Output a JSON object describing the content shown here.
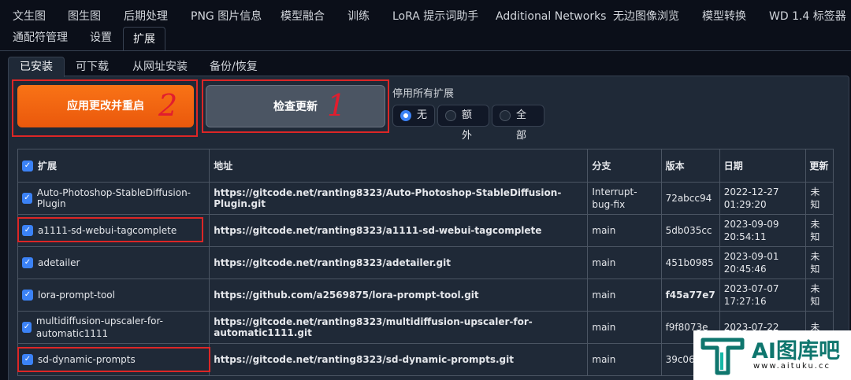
{
  "top_tabs": [
    "文生图",
    "图生图",
    "后期处理",
    "PNG 图片信息",
    "模型融合",
    "训练",
    "LoRA 提示词助手",
    "Additional Networks",
    "无边图像浏览",
    "模型转换",
    "WD 1.4 标签器",
    "通配符管理",
    "设置",
    "扩展"
  ],
  "sub_tabs": [
    "已安装",
    "可下载",
    "从网址安装",
    "备份/恢复"
  ],
  "buttons": {
    "apply": "应用更改并重启",
    "check": "检查更新"
  },
  "annotations": {
    "one": "1",
    "two": "2"
  },
  "disable": {
    "label": "停用所有扩展",
    "options": [
      "无",
      "额外",
      "全部"
    ],
    "selected": "无"
  },
  "table": {
    "headers": [
      "扩展",
      "地址",
      "分支",
      "版本",
      "日期",
      "更新"
    ],
    "rows": [
      {
        "name": "Auto-Photoshop-StableDiffusion-Plugin",
        "url": "https://gitcode.net/ranting8323/Auto-Photoshop-StableDiffusion-Plugin.git",
        "branch": "Interrupt-bug-fix",
        "version": "72abcc94",
        "date": "2022-12-27 01:29:20",
        "update": "未知"
      },
      {
        "name": "a1111-sd-webui-tagcomplete",
        "url": "https://gitcode.net/ranting8323/a1111-sd-webui-tagcomplete",
        "branch": "main",
        "version": "5db035cc",
        "date": "2023-09-09 20:54:11",
        "update": "未知"
      },
      {
        "name": "adetailer",
        "url": "https://gitcode.net/ranting8323/adetailer.git",
        "branch": "main",
        "version": "451b0985",
        "date": "2023-09-01 20:45:46",
        "update": "未知"
      },
      {
        "name": "lora-prompt-tool",
        "url": "https://github.com/a2569875/lora-prompt-tool.git",
        "branch": "main",
        "version": "f45a77e7",
        "date": "2023-07-07 17:27:16",
        "update": "未知"
      },
      {
        "name": "multidiffusion-upscaler-for-automatic1111",
        "url": "https://gitcode.net/ranting8323/multidiffusion-upscaler-for-automatic1111.git",
        "branch": "main",
        "version": "f9f8073e",
        "date": "2023-07-22",
        "update": "未"
      },
      {
        "name": "sd-dynamic-prompts",
        "url": "https://gitcode.net/ranting8323/sd-dynamic-prompts.git",
        "branch": "main",
        "version": "39c06",
        "date": "",
        "update": ""
      }
    ]
  },
  "watermark": {
    "brand": "AI图库吧",
    "url": "www.aituku.cc"
  }
}
